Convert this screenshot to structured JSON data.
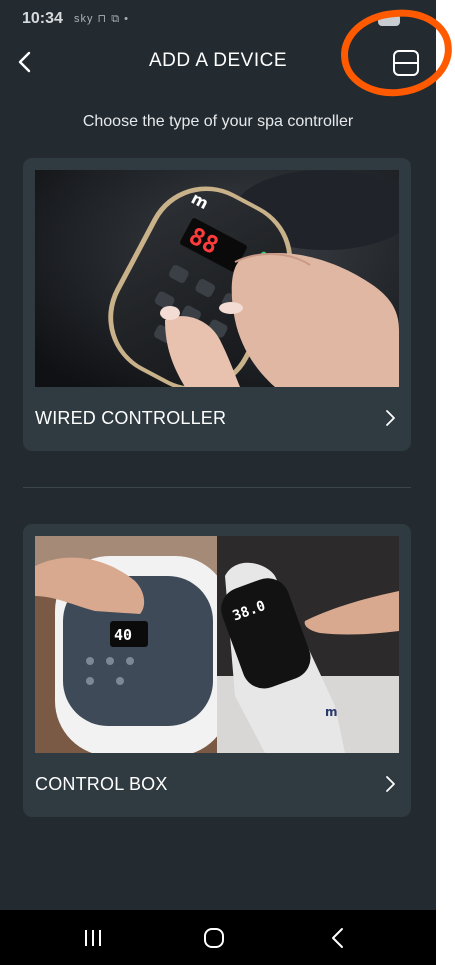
{
  "status_bar": {
    "time": "10:34",
    "icons": "sky ⊓ ⧉ •"
  },
  "header": {
    "title": "ADD A DEVICE"
  },
  "subtitle": "Choose the type of your spa controller",
  "cards": [
    {
      "label": "WIRED CONTROLLER",
      "image_alt": "Hand holding a wired spa remote controller",
      "display_value": "88",
      "brand": "m"
    },
    {
      "label": "CONTROL BOX",
      "image_alt": "Spa control boxes with touch panels",
      "display_value_left": "40",
      "display_value_right": "38.0",
      "brand": "m"
    }
  ],
  "colors": {
    "background": "#232b31",
    "card": "#2f3a41",
    "annotation": "#ff5a00"
  }
}
